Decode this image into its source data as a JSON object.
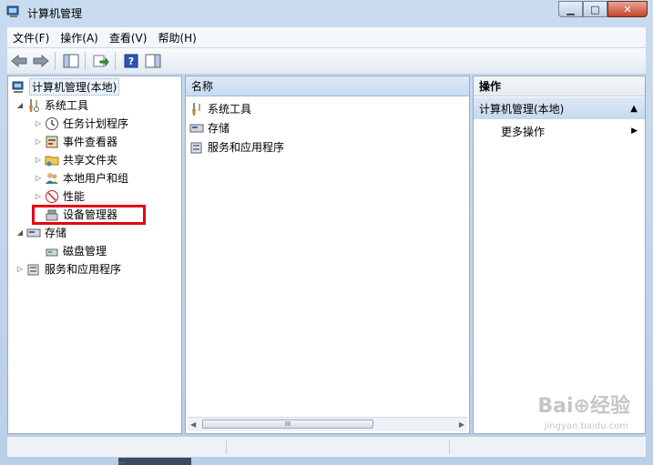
{
  "window": {
    "title": "计算机管理"
  },
  "caption": {
    "minimize": "▁",
    "maximize": "□",
    "close": "✕"
  },
  "menu": [
    "文件(F)",
    "操作(A)",
    "查看(V)",
    "帮助(H)"
  ],
  "toolbar": {
    "icons": [
      "back-arrow-icon",
      "forward-arrow-icon",
      "show-hide-tree-icon",
      "export-list-icon",
      "help-icon",
      "show-hide-action-pane-icon"
    ]
  },
  "tree": {
    "root": "计算机管理(本地)",
    "system_tools": "系统工具",
    "task_scheduler": "任务计划程序",
    "event_viewer": "事件查看器",
    "shared_folders": "共享文件夹",
    "local_users": "本地用户和组",
    "performance": "性能",
    "device_manager": "设备管理器",
    "storage": "存储",
    "disk_management": "磁盘管理",
    "services_apps": "服务和应用程序"
  },
  "center": {
    "column_header": "名称",
    "items": [
      "系统工具",
      "存储",
      "服务和应用程序"
    ],
    "scroll_grip": "III"
  },
  "actions": {
    "header": "操作",
    "group": "计算机管理(本地)",
    "more": "更多操作"
  },
  "watermark": {
    "logo": "Bai⊕经验",
    "url": "jingyan.baidu.com"
  },
  "taskbar_text": "…",
  "colors": {
    "highlight_box": "#e60012",
    "window_frame": "#b9cfe8"
  }
}
